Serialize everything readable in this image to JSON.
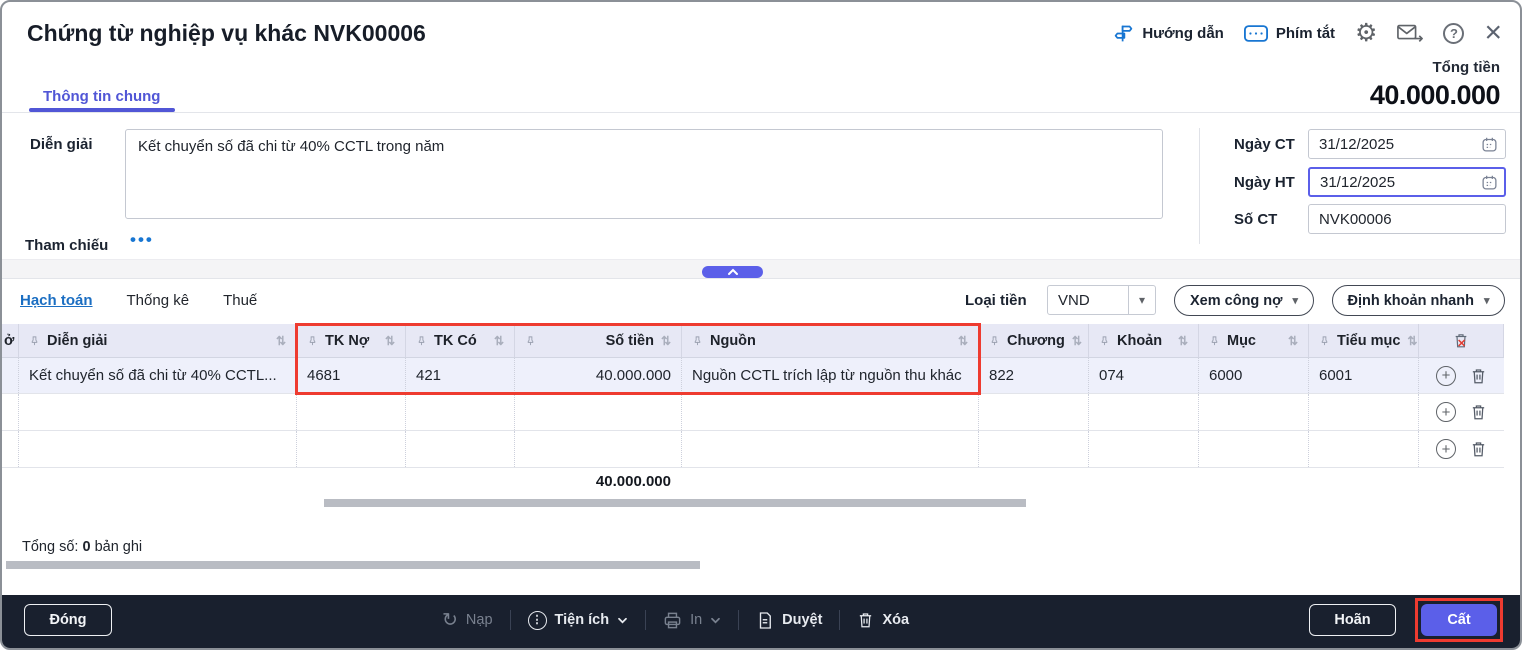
{
  "header": {
    "title": "Chứng từ nghiệp vụ khác NVK00006",
    "guide_label": "Hướng dẫn",
    "shortcut_label": "Phím tắt",
    "help_glyph": "?",
    "close_glyph": "×",
    "gear_glyph": "⚙",
    "total_label": "Tổng tiền",
    "total_value": "40.000.000"
  },
  "main_tab": {
    "label": "Thông tin chung"
  },
  "form": {
    "description_label": "Diễn giải",
    "description_value": "Kết chuyển số đã chi từ 40% CCTL trong năm",
    "reference_label": "Tham chiếu",
    "reference_dots": "•••",
    "ngay_ct_label": "Ngày CT",
    "ngay_ct_value": "31/12/2025",
    "ngay_ht_label": "Ngày HT",
    "ngay_ht_value": "31/12/2025",
    "so_ct_label": "Số CT",
    "so_ct_value": "NVK00006"
  },
  "grid_toolbar": {
    "tabs": [
      "Hạch toán",
      "Thống kê",
      "Thuế"
    ],
    "currency_label": "Loại tiền",
    "currency_value": "VND",
    "caret_glyph": "▾",
    "debt_button": "Xem công nợ",
    "quick_entry_button": "Định khoản nhanh"
  },
  "table": {
    "clipped_fragment": "ở",
    "sort_glyph": "⇅",
    "columns": [
      "Diễn giải",
      "TK Nợ",
      "TK Có",
      "Số tiền",
      "Nguồn",
      "Chương",
      "Khoản",
      "Mục",
      "Tiểu mục"
    ],
    "rows": [
      {
        "dien_giai": "Kết chuyển số đã chi từ 40% CCTL...",
        "tk_no": "4681",
        "tk_co": "421",
        "so_tien": "40.000.000",
        "nguon": "Nguồn CCTL trích lập từ nguồn thu khác",
        "chuong": "822",
        "khoan": "074",
        "muc": "6000",
        "tieu_muc": "6001"
      }
    ],
    "column_total": "40.000.000",
    "records_label": "Tổng số:",
    "records_count": "0",
    "records_unit": "bản ghi",
    "plus_glyph": "+"
  },
  "footer": {
    "close": "Đóng",
    "reload": "Nạp",
    "reload_glyph": "↻",
    "utilities": "Tiện ích",
    "utilities_dots": "⋮",
    "print": "In",
    "approve": "Duyệt",
    "delete": "Xóa",
    "postpone": "Hoãn",
    "save": "Cất"
  },
  "colors": {
    "accent_indigo": "#5b5fe9",
    "tab_purple": "#5156d6",
    "link_blue": "#1b6ec2",
    "icon_blue": "#1876d2",
    "annotation_red": "#ee3b30",
    "table_header_bg": "#e7e8f5",
    "row_highlight_bg": "#eef0fb",
    "toolbar_bg": "#19202e"
  }
}
